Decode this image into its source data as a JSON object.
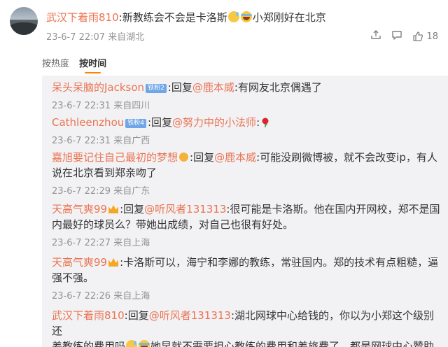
{
  "main_comment": {
    "username": "武汉下着雨810",
    "text_before": ":新教练会不会是卡洛斯",
    "text_after": "小郑刚好在北京",
    "date": "23-6-7 22:07",
    "location": "来自湖北",
    "like_count": "18"
  },
  "sort": {
    "hot_label": "按热度",
    "time_label": "按时间"
  },
  "replies": [
    {
      "username": "呆头呆脑的Jackson",
      "badge": "铁粉2",
      "prefix": ":回复",
      "target": "@鹿本威",
      "text": ":有网友北京偶遇了",
      "date": "23-6-7 22:31",
      "location": "来自四川"
    },
    {
      "username": "Cathleenzhou",
      "badge": "铁粉4",
      "prefix": ":回复",
      "target": "@努力中的小法师",
      "text": ":",
      "date": "23-6-7 22:31",
      "location": "来自广西"
    },
    {
      "username": "嘉旭要记住自己最初的梦想",
      "prefix": ":回复",
      "target": "@鹿本威",
      "text_line1": ":可能没刷微博被，就不会改变ip，有人",
      "text_line2": "说在北京看到郑亲吻了",
      "date": "23-6-7 22:29",
      "location": "来自广东"
    },
    {
      "username": "天高气爽99",
      "prefix": ":回复",
      "target": "@听风者131313",
      "text_line1": ":很可能是卡洛斯。他在国内开网校，郑不是国",
      "text_line2": "内最好的球员么？带她出成绩，对自己也很有好处。",
      "date": "23-6-7 22:27",
      "location": "来自上海"
    },
    {
      "username": "天高气爽99",
      "text_line1": ":卡洛斯可以，海宁和李娜的教练，常驻国内。郑的技术有点粗糙，逼",
      "text_line2": "强不强。",
      "date": "23-6-7 22:26",
      "location": "来自上海"
    },
    {
      "username": "武汉下着雨810",
      "prefix": ":回复",
      "target": "@听风者131313",
      "text_line1": ":湖北网球中心给钱的，你以为小郑这个级别还",
      "text_line2_a": "差教练的费用吗",
      "text_line2_b": "她早就不需要担心教练的费用和差旅费了，都是网球中心赞助"
    }
  ],
  "icons": {
    "share": "share-icon",
    "comment": "comment-icon",
    "like": "like-icon",
    "sweat_emoji": "sweat-smile-emoji",
    "laugh_emoji": "laugh-cry-emoji",
    "rose": "rose-emoji"
  },
  "colors": {
    "username": "#eb7350",
    "reply_background": "#f2f2f5",
    "meta": "#939393",
    "active_tab_underline": "#ff8200"
  }
}
